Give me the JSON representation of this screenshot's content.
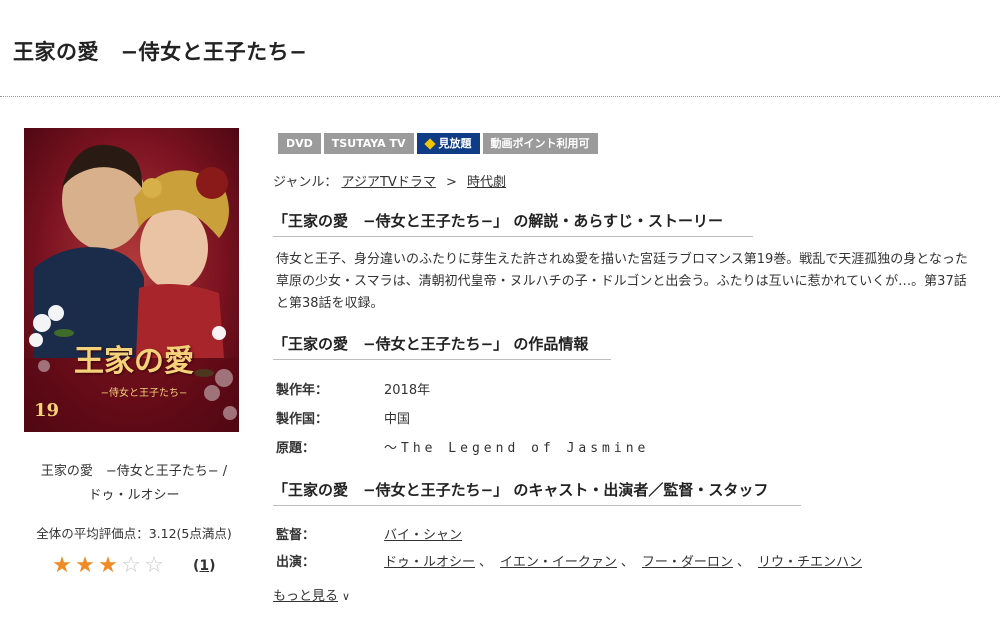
{
  "page": {
    "title": "王家の愛　−侍女と王子たち−"
  },
  "cover": {
    "title": "王家の愛",
    "subtitle": "−侍女と王子たち−",
    "volume": "19",
    "caption_line1": "王家の愛　−侍女と王子たち− /",
    "caption_line2": "ドゥ・ルオシー"
  },
  "rating": {
    "average_text": "全体の平均評価点：3.12(5点満点)",
    "average": 3.12,
    "max": 5,
    "count": "1",
    "count_open": "(",
    "count_close": ")"
  },
  "badges": {
    "dvd": "DVD",
    "tsutaya_tv": "TSUTAYA TV",
    "unlimited": "見放題",
    "points": "動画ポイント利用可"
  },
  "genre": {
    "label": "ジャンル：",
    "primary": "アジアTVドラマ",
    "separator": ">",
    "secondary": "時代劇"
  },
  "synopsis": {
    "heading": "「王家の愛　−侍女と王子たち−」 の解説・あらすじ・ストーリー",
    "text": "侍女と王子、身分違いのふたりに芽生えた許されぬ愛を描いた宮廷ラブロマンス第19巻。戦乱で天涯孤独の身となった草原の少女・スマラは、清朝初代皇帝・ヌルハチの子・ドルゴンと出会う。ふたりは互いに惹かれていくが…。第37話と第38話を収録。"
  },
  "info": {
    "heading": "「王家の愛　−侍女と王子たち−」 の作品情報",
    "year_label": "製作年：",
    "year_value": "2018年",
    "country_label": "製作国：",
    "country_value": "中国",
    "original_label": "原題：",
    "original_value": "〜The Legend of Jasmine"
  },
  "cast": {
    "heading": "「王家の愛　−侍女と王子たち−」 のキャスト・出演者／監督・スタッフ",
    "director_label": "監督：",
    "director": "バイ・シャン",
    "actors_label": "出演：",
    "actors": [
      "ドゥ・ルオシー",
      "イエン・イークァン",
      "フー・ダーロン",
      "リウ・チエンハン"
    ],
    "separator": "、",
    "more_label": "もっと見る"
  }
}
